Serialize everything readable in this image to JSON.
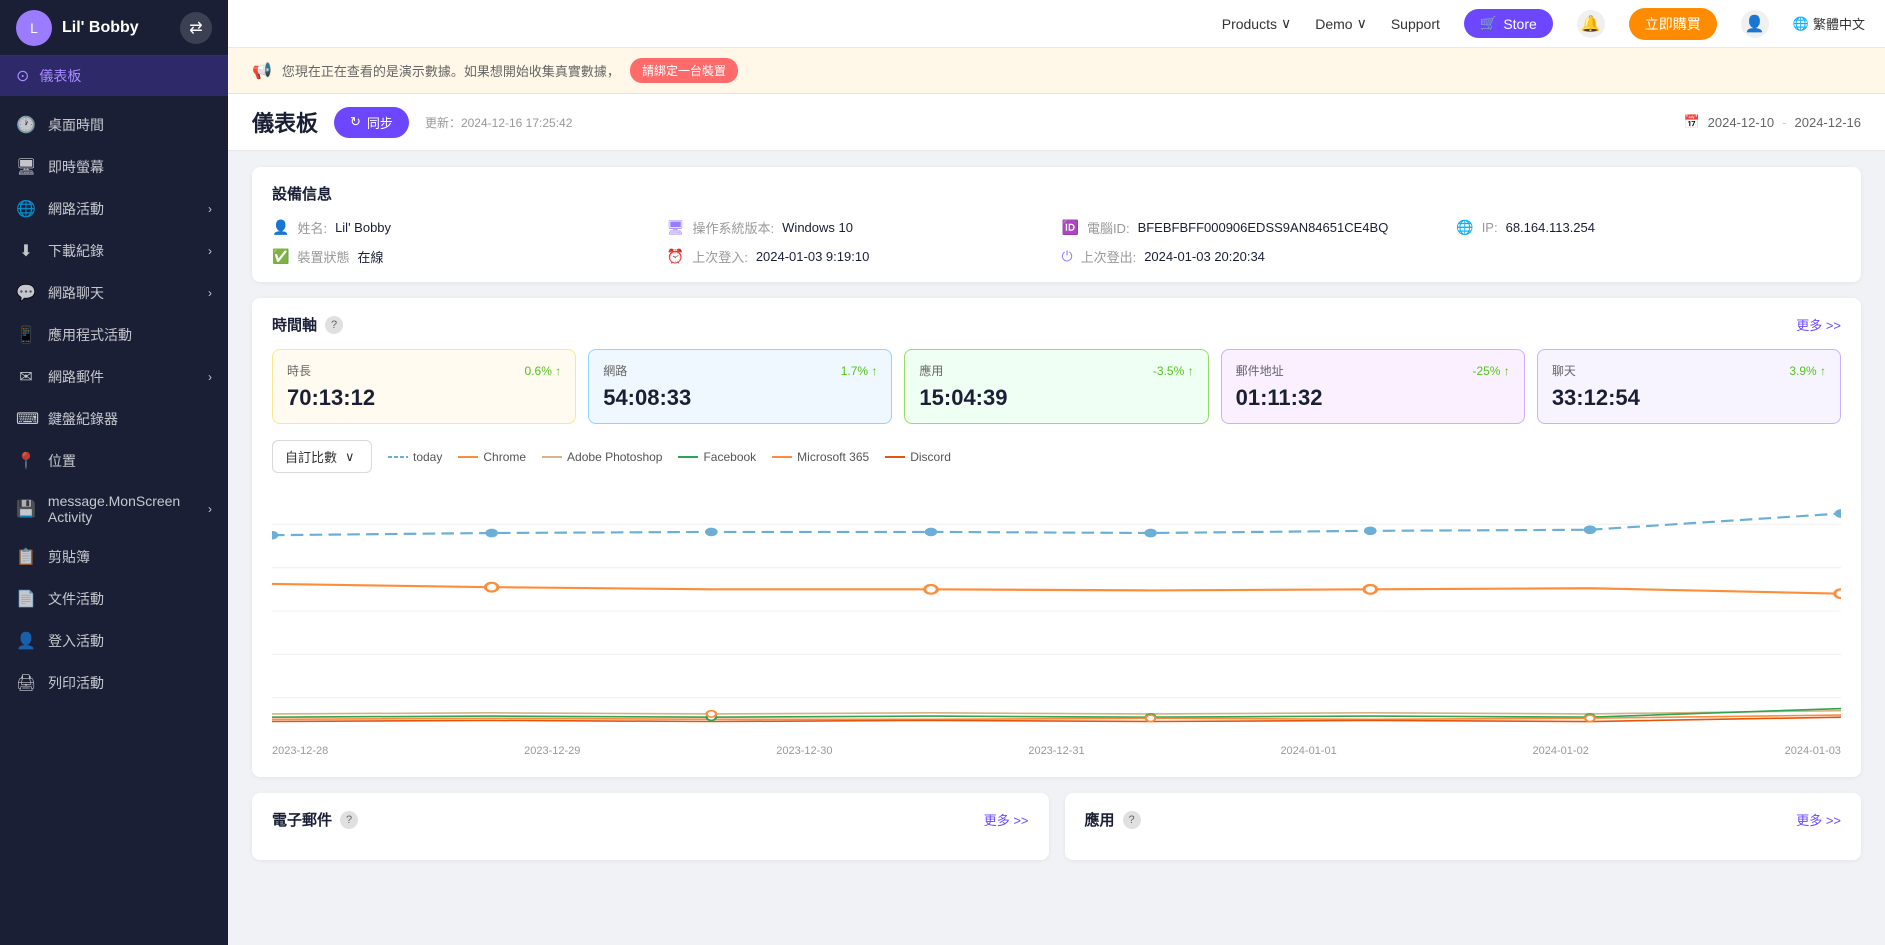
{
  "brand": {
    "name": "Lil' Bobby",
    "avatar_initial": "L"
  },
  "topnav": {
    "products_label": "Products",
    "demo_label": "Demo",
    "support_label": "Support",
    "store_label": "Store",
    "buy_label": "立即購買",
    "lang_label": "繁體中文"
  },
  "sidebar": {
    "items": [
      {
        "id": "dashboard",
        "label": "儀表板",
        "icon": "⊙",
        "active": true
      },
      {
        "id": "desktop-time",
        "label": "桌面時間",
        "icon": "🕐"
      },
      {
        "id": "screenshot",
        "label": "即時螢幕",
        "icon": "🖥"
      },
      {
        "id": "network",
        "label": "網路活動",
        "icon": "🌐",
        "has_children": true
      },
      {
        "id": "downloads",
        "label": "下載紀錄",
        "icon": "⬇",
        "has_children": true
      },
      {
        "id": "chat",
        "label": "網路聊天",
        "icon": "💬",
        "has_children": true
      },
      {
        "id": "app-activity",
        "label": "應用程式活動",
        "icon": "📱"
      },
      {
        "id": "email",
        "label": "網路郵件",
        "icon": "✉",
        "has_children": true
      },
      {
        "id": "keyboard",
        "label": "鍵盤紀錄器",
        "icon": "⌨"
      },
      {
        "id": "location",
        "label": "位置",
        "icon": "📍"
      },
      {
        "id": "monscreen",
        "label": "message.MonScreen Activity",
        "icon": "💾",
        "has_children": true
      },
      {
        "id": "clipboard",
        "label": "剪貼簿",
        "icon": "👤"
      },
      {
        "id": "file-activity",
        "label": "文件活動",
        "icon": "📄"
      },
      {
        "id": "login-activity",
        "label": "登入活動",
        "icon": "👤"
      },
      {
        "id": "print-activity",
        "label": "列印活動",
        "icon": "🖨"
      }
    ]
  },
  "banner": {
    "text": "您現在正在查看的是演示數據。如果想開始收集真實數據，",
    "link_text": "請綁定一台裝置"
  },
  "dashboard": {
    "title": "儀表板",
    "sync_label": "同步",
    "update_prefix": "更新：",
    "update_time": "2024-12-16 17:25:42",
    "date_start": "2024-12-10",
    "date_end": "2024-12-16"
  },
  "device_info": {
    "section_title": "設備信息",
    "name_label": "姓名:",
    "name_value": "Lil' Bobby",
    "os_label": "操作系統版本:",
    "os_value": "Windows 10",
    "device_id_label": "電腦ID:",
    "device_id_value": "BFEBFBFF000906EDSS9AN84651CE4BQ",
    "ip_label": "IP:",
    "ip_value": "68.164.113.254",
    "status_label": "裝置狀態",
    "status_value": "在線",
    "last_login_label": "上次登入:",
    "last_login_value": "2024-01-03 9:19:10",
    "last_logout_label": "上次登出:",
    "last_logout_value": "2024-01-03 20:20:34"
  },
  "timeline": {
    "section_title": "時間軸",
    "more_label": "更多 >>",
    "dropdown_label": "自訂比數",
    "stats": [
      {
        "label": "時長",
        "change": "0.6% ↑",
        "value": "70:13:12",
        "color_class": "stat-box-yellow"
      },
      {
        "label": "網路",
        "change": "1.7% ↑",
        "value": "54:08:33",
        "color_class": "stat-box-blue"
      },
      {
        "label": "應用",
        "change": "-3.5% ↑",
        "value": "15:04:39",
        "color_class": "stat-box-green"
      },
      {
        "label": "郵件地址",
        "change": "-25% ↑",
        "value": "01:11:32",
        "color_class": "stat-box-purple"
      },
      {
        "label": "聊天",
        "change": "3.9% ↑",
        "value": "33:12:54",
        "color_class": "stat-box-lavender"
      }
    ],
    "legend": [
      {
        "label": "today",
        "color": "#6baed6",
        "dashed": true
      },
      {
        "label": "Chrome",
        "color": "#fd8d3c"
      },
      {
        "label": "Adobe Photoshop",
        "color": "#d4b483"
      },
      {
        "label": "Facebook",
        "color": "#31a354"
      },
      {
        "label": "Microsoft 365",
        "color": "#fd8d3c"
      },
      {
        "label": "Discord",
        "color": "#e6550d"
      }
    ],
    "x_labels": [
      "2023-12-28",
      "2023-12-29",
      "2023-12-30",
      "2023-12-31",
      "2024-01-01",
      "2024-01-02",
      "2024-01-03"
    ]
  },
  "bottom_sections": [
    {
      "title": "電子郵件",
      "more": "更多 >>"
    },
    {
      "title": "應用",
      "more": "更多 >>"
    }
  ]
}
